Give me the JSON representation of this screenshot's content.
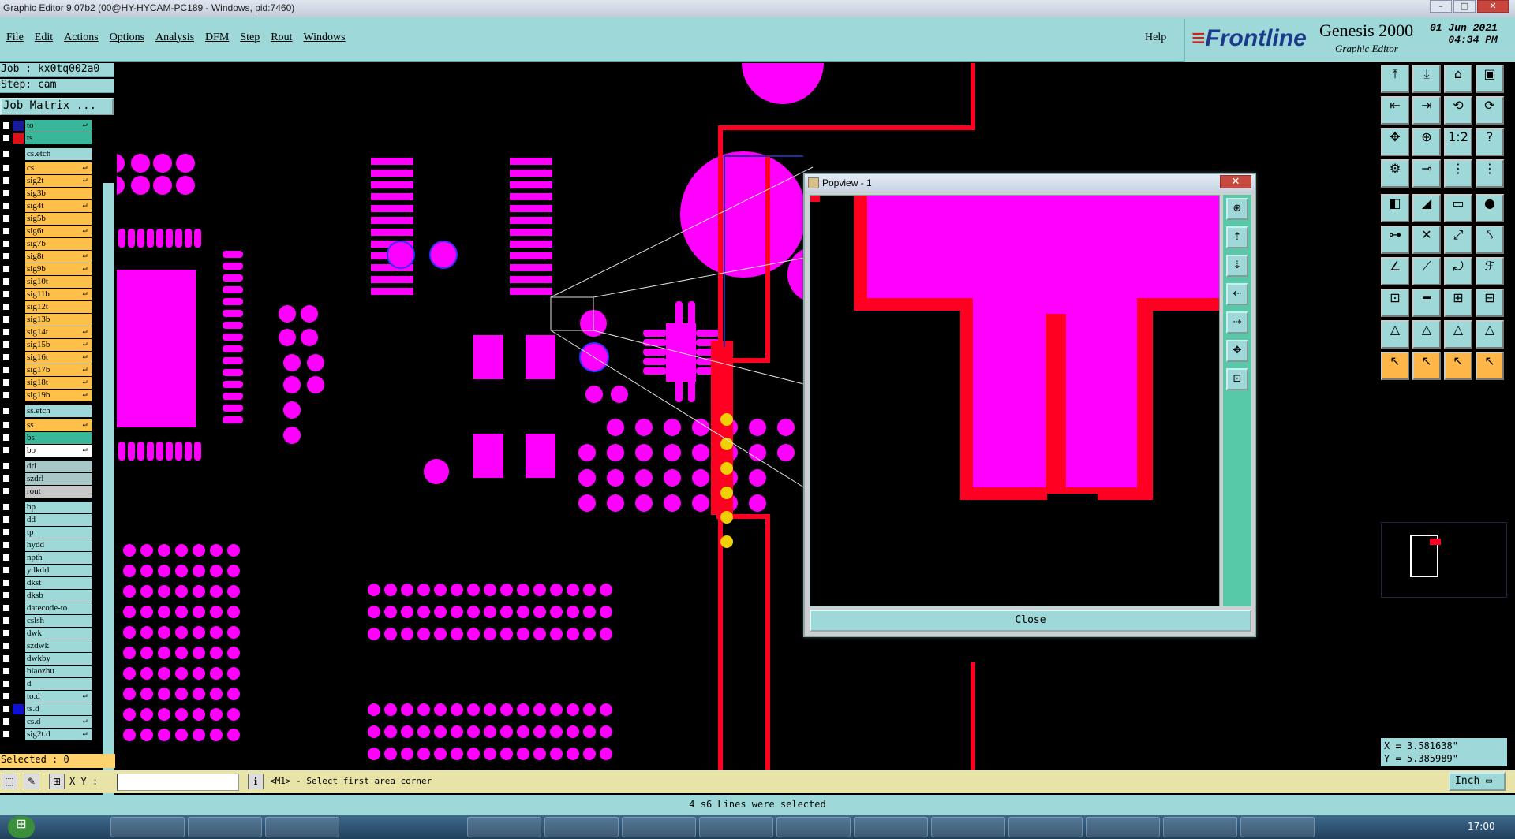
{
  "window": {
    "title": "Graphic Editor 9.07b2 (00@HY-HYCAM-PC189 - Windows, pid:7460)",
    "minimize": "–",
    "maximize": "□",
    "close": "✕"
  },
  "menu": {
    "items": [
      "File",
      "Edit",
      "Actions",
      "Options",
      "Analysis",
      "DFM",
      "Step",
      "Rout",
      "Windows"
    ],
    "help": "Help"
  },
  "brand": {
    "logo_prefix": "≡",
    "logo": "Frontline",
    "product": "Genesis 2000",
    "subtitle": "Graphic Editor",
    "date": "01 Jun 2021",
    "time": "04:34 PM"
  },
  "job": {
    "job_label": "Job : kx0tq002a0",
    "step_label": "Step: cam",
    "matrix_button": "Job Matrix ..."
  },
  "layers": [
    {
      "name": "to",
      "color": "#39b79a",
      "box": "#1a1a9a",
      "arrow": "↵"
    },
    {
      "name": "ts",
      "color": "#39b79a",
      "box": "#e0101a",
      "arrow": ""
    },
    {
      "name": "cs.etch",
      "color": "#9fd8d8",
      "box": "",
      "arrow": ""
    },
    {
      "name": "cs",
      "color": "#ffc04a",
      "box": "",
      "arrow": "↵"
    },
    {
      "name": "sig2t",
      "color": "#ffc04a",
      "box": "",
      "arrow": "↵"
    },
    {
      "name": "sig3b",
      "color": "#ffc04a",
      "box": "",
      "arrow": ""
    },
    {
      "name": "sig4t",
      "color": "#ffc04a",
      "box": "",
      "arrow": "↵"
    },
    {
      "name": "sig5b",
      "color": "#ffc04a",
      "box": "",
      "arrow": ""
    },
    {
      "name": "sig6t",
      "color": "#ffc04a",
      "box": "",
      "arrow": "↵"
    },
    {
      "name": "sig7b",
      "color": "#ffc04a",
      "box": "",
      "arrow": ""
    },
    {
      "name": "sig8t",
      "color": "#ffc04a",
      "box": "",
      "arrow": "↵"
    },
    {
      "name": "sig9b",
      "color": "#ffc04a",
      "box": "",
      "arrow": "↵"
    },
    {
      "name": "sig10t",
      "color": "#ffc04a",
      "box": "",
      "arrow": ""
    },
    {
      "name": "sig11b",
      "color": "#ffc04a",
      "box": "",
      "arrow": "↵"
    },
    {
      "name": "sig12t",
      "color": "#ffc04a",
      "box": "",
      "arrow": ""
    },
    {
      "name": "sig13b",
      "color": "#ffc04a",
      "box": "",
      "arrow": ""
    },
    {
      "name": "sig14t",
      "color": "#ffc04a",
      "box": "",
      "arrow": "↵"
    },
    {
      "name": "sig15b",
      "color": "#ffc04a",
      "box": "",
      "arrow": "↵"
    },
    {
      "name": "sig16t",
      "color": "#ffc04a",
      "box": "",
      "arrow": "↵"
    },
    {
      "name": "sig17b",
      "color": "#ffc04a",
      "box": "",
      "arrow": "↵"
    },
    {
      "name": "sig18t",
      "color": "#ffc04a",
      "box": "",
      "arrow": "↵"
    },
    {
      "name": "sig19b",
      "color": "#ffc04a",
      "box": "",
      "arrow": "↵"
    },
    {
      "name": "ss.etch",
      "color": "#9fd8d8",
      "box": "",
      "arrow": ""
    },
    {
      "name": "ss",
      "color": "#ffc04a",
      "box": "",
      "arrow": "↵"
    },
    {
      "name": "bs",
      "color": "#39b79a",
      "box": "",
      "arrow": ""
    },
    {
      "name": "bo",
      "color": "#ffffff",
      "box": "",
      "arrow": "↵"
    },
    {
      "name": "drl",
      "color": "#a8c8c8",
      "box": "",
      "arrow": ""
    },
    {
      "name": "szdrl",
      "color": "#a8c8c8",
      "box": "",
      "arrow": ""
    },
    {
      "name": "rout",
      "color": "#c8c8c8",
      "box": "",
      "arrow": ""
    },
    {
      "name": "bp",
      "color": "#9fd8d8",
      "box": "",
      "arrow": ""
    },
    {
      "name": "dd",
      "color": "#9fd8d8",
      "box": "",
      "arrow": ""
    },
    {
      "name": "tp",
      "color": "#9fd8d8",
      "box": "",
      "arrow": ""
    },
    {
      "name": "hydd",
      "color": "#9fd8d8",
      "box": "",
      "arrow": ""
    },
    {
      "name": "npth",
      "color": "#9fd8d8",
      "box": "",
      "arrow": ""
    },
    {
      "name": "ydkdrl",
      "color": "#9fd8d8",
      "box": "",
      "arrow": ""
    },
    {
      "name": "dkst",
      "color": "#9fd8d8",
      "box": "",
      "arrow": ""
    },
    {
      "name": "dksb",
      "color": "#9fd8d8",
      "box": "",
      "arrow": ""
    },
    {
      "name": "datecode-to",
      "color": "#9fd8d8",
      "box": "",
      "arrow": ""
    },
    {
      "name": "cslsh",
      "color": "#9fd8d8",
      "box": "",
      "arrow": ""
    },
    {
      "name": "dwk",
      "color": "#9fd8d8",
      "box": "",
      "arrow": ""
    },
    {
      "name": "szdwk",
      "color": "#9fd8d8",
      "box": "",
      "arrow": ""
    },
    {
      "name": "dwkby",
      "color": "#9fd8d8",
      "box": "",
      "arrow": ""
    },
    {
      "name": "biaozhu",
      "color": "#9fd8d8",
      "box": "",
      "arrow": ""
    },
    {
      "name": "d",
      "color": "#9fd8d8",
      "box": "",
      "arrow": ""
    },
    {
      "name": "to.d",
      "color": "#9fd8d8",
      "box": "",
      "arrow": "↵"
    },
    {
      "name": "ts.d",
      "color": "#9fd8d8",
      "box": "#1010d0",
      "arrow": ""
    },
    {
      "name": "cs.d",
      "color": "#9fd8d8",
      "box": "",
      "arrow": "↵"
    },
    {
      "name": "sig2t.d",
      "color": "#9fd8d8",
      "box": "",
      "arrow": "↵"
    }
  ],
  "selected": "Selected : 0",
  "popview": {
    "title": "Popview - 1",
    "close_button": "Close"
  },
  "coords": {
    "x": "X = 3.581638\"",
    "y": "Y = 5.385989\""
  },
  "status": {
    "xy_label": "X Y :",
    "prompt": "<M1> - Select first area corner",
    "units": "Inch",
    "message": "4 s6 Lines were selected"
  },
  "taskbar": {
    "start": "⊞",
    "clock": "17:00"
  },
  "colors": {
    "pad": "#ff00ff",
    "trace": "#ff0022",
    "drill": "#f0d000",
    "panel": "#9fd8d8",
    "active": "#ffc04a"
  }
}
